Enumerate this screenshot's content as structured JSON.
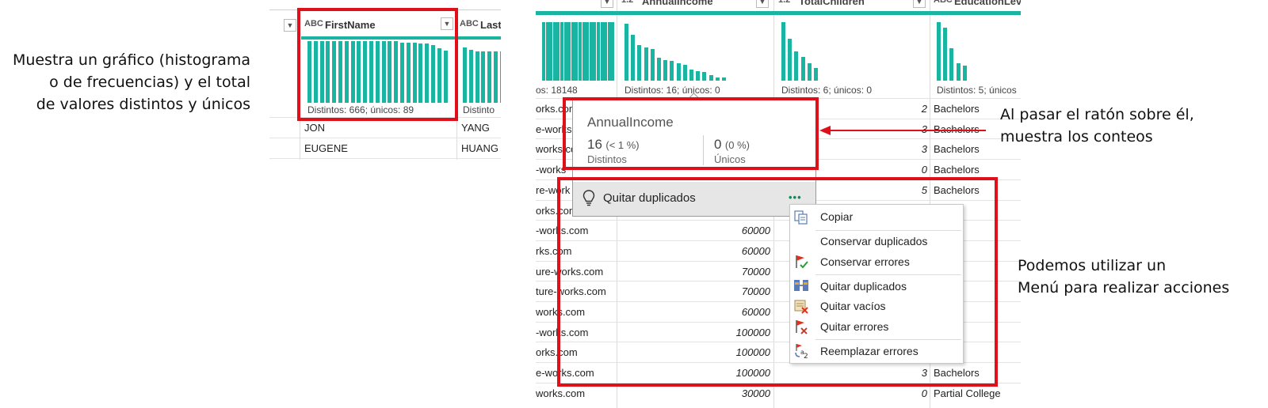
{
  "annotations": {
    "left_lines": [
      "Muestra un gráfico (histograma",
      "o de frecuencias) y el total",
      "de valores distintos y únicos"
    ],
    "hover_lines": [
      "Al pasar el ratón sobre él,",
      "muestra los conteos"
    ],
    "menu_lines": [
      "Podemos utilizar un",
      "Menú para realizar acciones"
    ]
  },
  "left_table": {
    "col1_type": "ABC",
    "col1_name": "FirstName",
    "col2_type": "ABC",
    "col2_name": "Last",
    "col1_summary": "Distintos: 666; únicos: 89",
    "col2_summary": "Distinto",
    "rows": [
      [
        "JON",
        "YANG"
      ],
      [
        "EUGENE",
        "HUANG"
      ]
    ]
  },
  "right_table": {
    "headers": [
      {
        "type": "1.2",
        "name": "AnnualIncome"
      },
      {
        "type": "1.2",
        "name": "TotalChildren"
      },
      {
        "type": "ABC",
        "name": "EducationLev"
      }
    ],
    "summaries": [
      "os: 18148",
      "Distintos: 16; únicos: 0",
      "Distintos: 6; únicos: 0",
      "Distintos: 5; únicos"
    ],
    "rows": [
      {
        "email": "orks.com",
        "income": "",
        "children": "2",
        "edu": "Bachelors"
      },
      {
        "email": "e-works",
        "income": "",
        "children": "3",
        "edu": "Bachelors"
      },
      {
        "email": "works.co",
        "income": "",
        "children": "3",
        "edu": "Bachelors"
      },
      {
        "email": "-works",
        "income": "",
        "children": "0",
        "edu": "Bachelors"
      },
      {
        "email": "re-work",
        "income": "",
        "children": "5",
        "edu": "Bachelors"
      },
      {
        "email": "orks.con",
        "income": "",
        "children": "",
        "edu": "elors"
      },
      {
        "email": "-works.com",
        "income": "60000",
        "children": "",
        "edu": "elors"
      },
      {
        "email": "rks.com",
        "income": "60000",
        "children": "",
        "edu": "elors"
      },
      {
        "email": "ure-works.com",
        "income": "70000",
        "children": "",
        "edu": "elors"
      },
      {
        "email": "ture-works.com",
        "income": "70000",
        "children": "",
        "edu": "elors"
      },
      {
        "email": "works.com",
        "income": "60000",
        "children": "",
        "edu": "elors"
      },
      {
        "email": "-works.com",
        "income": "100000",
        "children": "",
        "edu": "elors"
      },
      {
        "email": "orks.com",
        "income": "100000",
        "children": "",
        "edu": "elors"
      },
      {
        "email": "e-works.com",
        "income": "100000",
        "children": "3",
        "edu": "Bachelors"
      },
      {
        "email": "works.com",
        "income": "30000",
        "children": "0",
        "edu": "Partial College"
      }
    ]
  },
  "tooltip": {
    "title": "AnnualIncome",
    "distinct_value": "16",
    "distinct_pct": "(< 1 %)",
    "distinct_label": "Distintos",
    "unique_value": "0",
    "unique_pct": "(0 %)",
    "unique_label": "Únicos",
    "action_label": "Quitar duplicados",
    "more_label": "•••"
  },
  "context_menu": {
    "items": [
      "Copiar",
      "Conservar duplicados",
      "Conservar errores",
      "Quitar duplicados",
      "Quitar vacíos",
      "Quitar errores",
      "Reemplazar errores"
    ]
  },
  "colors": {
    "accent": "#19b4a2",
    "highlight": "#e0101a"
  },
  "histograms": {
    "firstname": [
      1.0,
      1.0,
      1.0,
      1.0,
      1.0,
      1.0,
      1.0,
      1.0,
      1.0,
      1.0,
      1.0,
      1.0,
      1.0,
      1.0,
      1.0,
      0.98,
      0.98,
      0.98,
      0.96,
      0.96,
      0.93,
      0.88,
      0.85
    ],
    "lastname": [
      0.95,
      0.9,
      0.88,
      0.88,
      0.88,
      0.88,
      0.88,
      0.88,
      0.88,
      0.88,
      0.88
    ],
    "email": [
      1.0,
      1.0,
      1.0,
      1.0,
      1.0,
      1.0,
      1.0,
      1.0,
      1.0,
      1.0,
      1.0,
      1.0,
      1.0,
      1.0,
      1.0,
      1.0,
      1.0,
      1.0,
      1.0,
      1.0
    ],
    "income": [
      1.0,
      0.8,
      0.62,
      0.58,
      0.55,
      0.4,
      0.36,
      0.35,
      0.3,
      0.28,
      0.2,
      0.16,
      0.15,
      0.1,
      0.06,
      0.06
    ],
    "children": [
      1.0,
      0.72,
      0.5,
      0.4,
      0.3,
      0.22
    ],
    "education": [
      1.0,
      0.9,
      0.55,
      0.3,
      0.25
    ]
  }
}
